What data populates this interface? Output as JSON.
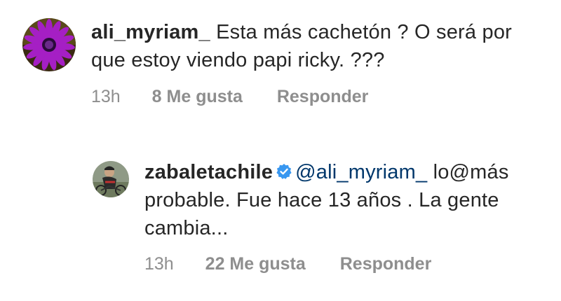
{
  "comments": [
    {
      "username": "ali_myriam_",
      "text": "Esta más cachetón ? O será por que estoy viendo papi ricky. ???",
      "time": "13h",
      "likes": "8 Me gusta",
      "reply_label": "Responder",
      "avatar_icon": "purple-flower-avatar"
    },
    {
      "username": "zabaletachile",
      "verified_icon": "verified-badge-icon",
      "mention": "@ali_myriam_",
      "text": "lo@más probable. Fue hace 13 años . La gente cambia...",
      "time": "13h",
      "likes": "22 Me gusta",
      "reply_label": "Responder",
      "avatar_icon": "cyclist-photo-avatar"
    }
  ],
  "colors": {
    "text": "#262626",
    "secondary": "#8e8e8e",
    "mention": "#00376b",
    "verified": "#3897f0"
  }
}
